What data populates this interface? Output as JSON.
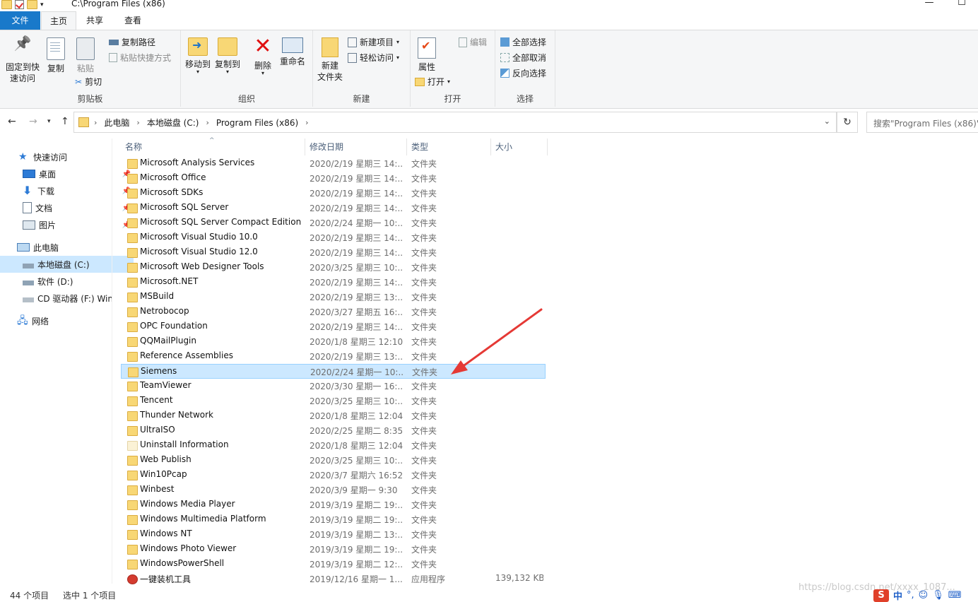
{
  "window": {
    "title": "C:\\Program Files (x86)",
    "minimize": "—",
    "maximize": "☐"
  },
  "ribbon_tabs": [
    "文件",
    "主页",
    "共享",
    "查看"
  ],
  "ribbon": {
    "clipboard": {
      "pin_label_1": "固定到快",
      "pin_label_2": "速访问",
      "copy": "复制",
      "paste": "粘贴",
      "copy_path": "复制路径",
      "paste_shortcut": "粘贴快捷方式",
      "cut": "剪切",
      "group": "剪贴板"
    },
    "organize": {
      "move_to": "移动到",
      "copy_to": "复制到",
      "delete": "删除",
      "rename": "重命名",
      "group": "组织"
    },
    "new": {
      "new_folder_1": "新建",
      "new_folder_2": "文件夹",
      "new_item": "新建项目",
      "easy_access": "轻松访问",
      "group": "新建"
    },
    "open": {
      "properties": "属性",
      "open": "打开",
      "edit": "编辑",
      "group": "打开"
    },
    "select": {
      "select_all": "全部选择",
      "select_none": "全部取消",
      "invert": "反向选择",
      "group": "选择"
    }
  },
  "address": {
    "crumbs": [
      "此电脑",
      "本地磁盘 (C:)",
      "Program Files (x86)"
    ],
    "search_placeholder": "搜索\"Program Files (x86)\""
  },
  "nav": {
    "quick_access": "快速访问",
    "desktop": "桌面",
    "downloads": "下载",
    "documents": "文档",
    "pictures": "图片",
    "this_pc": "此电脑",
    "local_c": "本地磁盘 (C:)",
    "software_d": "软件 (D:)",
    "cd_drive": "CD 驱动器 (F:) Win",
    "network": "网络"
  },
  "columns": {
    "name": "名称",
    "date": "修改日期",
    "type": "类型",
    "size": "大小"
  },
  "files": [
    {
      "name": "Microsoft Analysis Services",
      "date": "2020/2/19 星期三 14:...",
      "type": "文件夹",
      "size": ""
    },
    {
      "name": "Microsoft Office",
      "date": "2020/2/19 星期三 14:...",
      "type": "文件夹",
      "size": ""
    },
    {
      "name": "Microsoft SDKs",
      "date": "2020/2/19 星期三 14:...",
      "type": "文件夹",
      "size": ""
    },
    {
      "name": "Microsoft SQL Server",
      "date": "2020/2/19 星期三 14:...",
      "type": "文件夹",
      "size": ""
    },
    {
      "name": "Microsoft SQL Server Compact Edition",
      "date": "2020/2/24 星期一 10:...",
      "type": "文件夹",
      "size": ""
    },
    {
      "name": "Microsoft Visual Studio 10.0",
      "date": "2020/2/19 星期三 14:...",
      "type": "文件夹",
      "size": ""
    },
    {
      "name": "Microsoft Visual Studio 12.0",
      "date": "2020/2/19 星期三 14:...",
      "type": "文件夹",
      "size": ""
    },
    {
      "name": "Microsoft Web Designer Tools",
      "date": "2020/3/25 星期三 10:...",
      "type": "文件夹",
      "size": ""
    },
    {
      "name": "Microsoft.NET",
      "date": "2020/2/19 星期三 14:...",
      "type": "文件夹",
      "size": ""
    },
    {
      "name": "MSBuild",
      "date": "2020/2/19 星期三 13:...",
      "type": "文件夹",
      "size": ""
    },
    {
      "name": "Netrobocop",
      "date": "2020/3/27 星期五 16:...",
      "type": "文件夹",
      "size": ""
    },
    {
      "name": "OPC Foundation",
      "date": "2020/2/19 星期三 14:...",
      "type": "文件夹",
      "size": ""
    },
    {
      "name": "QQMailPlugin",
      "date": "2020/1/8 星期三 12:10",
      "type": "文件夹",
      "size": ""
    },
    {
      "name": "Reference Assemblies",
      "date": "2020/2/19 星期三 13:...",
      "type": "文件夹",
      "size": ""
    },
    {
      "name": "Siemens",
      "date": "2020/2/24 星期一 10:...",
      "type": "文件夹",
      "size": "",
      "selected": true
    },
    {
      "name": "TeamViewer",
      "date": "2020/3/30 星期一 16:...",
      "type": "文件夹",
      "size": ""
    },
    {
      "name": "Tencent",
      "date": "2020/3/25 星期三 10:...",
      "type": "文件夹",
      "size": ""
    },
    {
      "name": "Thunder Network",
      "date": "2020/1/8 星期三 12:04",
      "type": "文件夹",
      "size": ""
    },
    {
      "name": "UltraISO",
      "date": "2020/2/25 星期二 8:35",
      "type": "文件夹",
      "size": ""
    },
    {
      "name": "Uninstall Information",
      "date": "2020/1/8 星期三 12:04",
      "type": "文件夹",
      "size": "",
      "icon": "pale"
    },
    {
      "name": "Web Publish",
      "date": "2020/3/25 星期三 10:...",
      "type": "文件夹",
      "size": ""
    },
    {
      "name": "Win10Pcap",
      "date": "2020/3/7 星期六 16:52",
      "type": "文件夹",
      "size": ""
    },
    {
      "name": "Winbest",
      "date": "2020/3/9 星期一 9:30",
      "type": "文件夹",
      "size": ""
    },
    {
      "name": "Windows Media Player",
      "date": "2019/3/19 星期二 19:...",
      "type": "文件夹",
      "size": ""
    },
    {
      "name": "Windows Multimedia Platform",
      "date": "2019/3/19 星期二 19:...",
      "type": "文件夹",
      "size": ""
    },
    {
      "name": "Windows NT",
      "date": "2019/3/19 星期二 13:...",
      "type": "文件夹",
      "size": ""
    },
    {
      "name": "Windows Photo Viewer",
      "date": "2019/3/19 星期二 19:...",
      "type": "文件夹",
      "size": ""
    },
    {
      "name": "WindowsPowerShell",
      "date": "2019/3/19 星期二 12:...",
      "type": "文件夹",
      "size": ""
    },
    {
      "name": "一键装机工具",
      "date": "2019/12/16 星期一 1...",
      "type": "应用程序",
      "size": "139,132 KB",
      "icon": "app"
    }
  ],
  "status": {
    "count": "44 个项目",
    "selected": "选中 1 个项目"
  },
  "watermark": "https://blog.csdn.net/xxxx_1087...",
  "ime": {
    "logo": "S",
    "lang": "中",
    "punct": "°,"
  },
  "colors": {
    "accent": "#1979ca",
    "selection": "#cce8ff",
    "folder": "#f8d775",
    "annotation_arrow": "#e53935"
  }
}
